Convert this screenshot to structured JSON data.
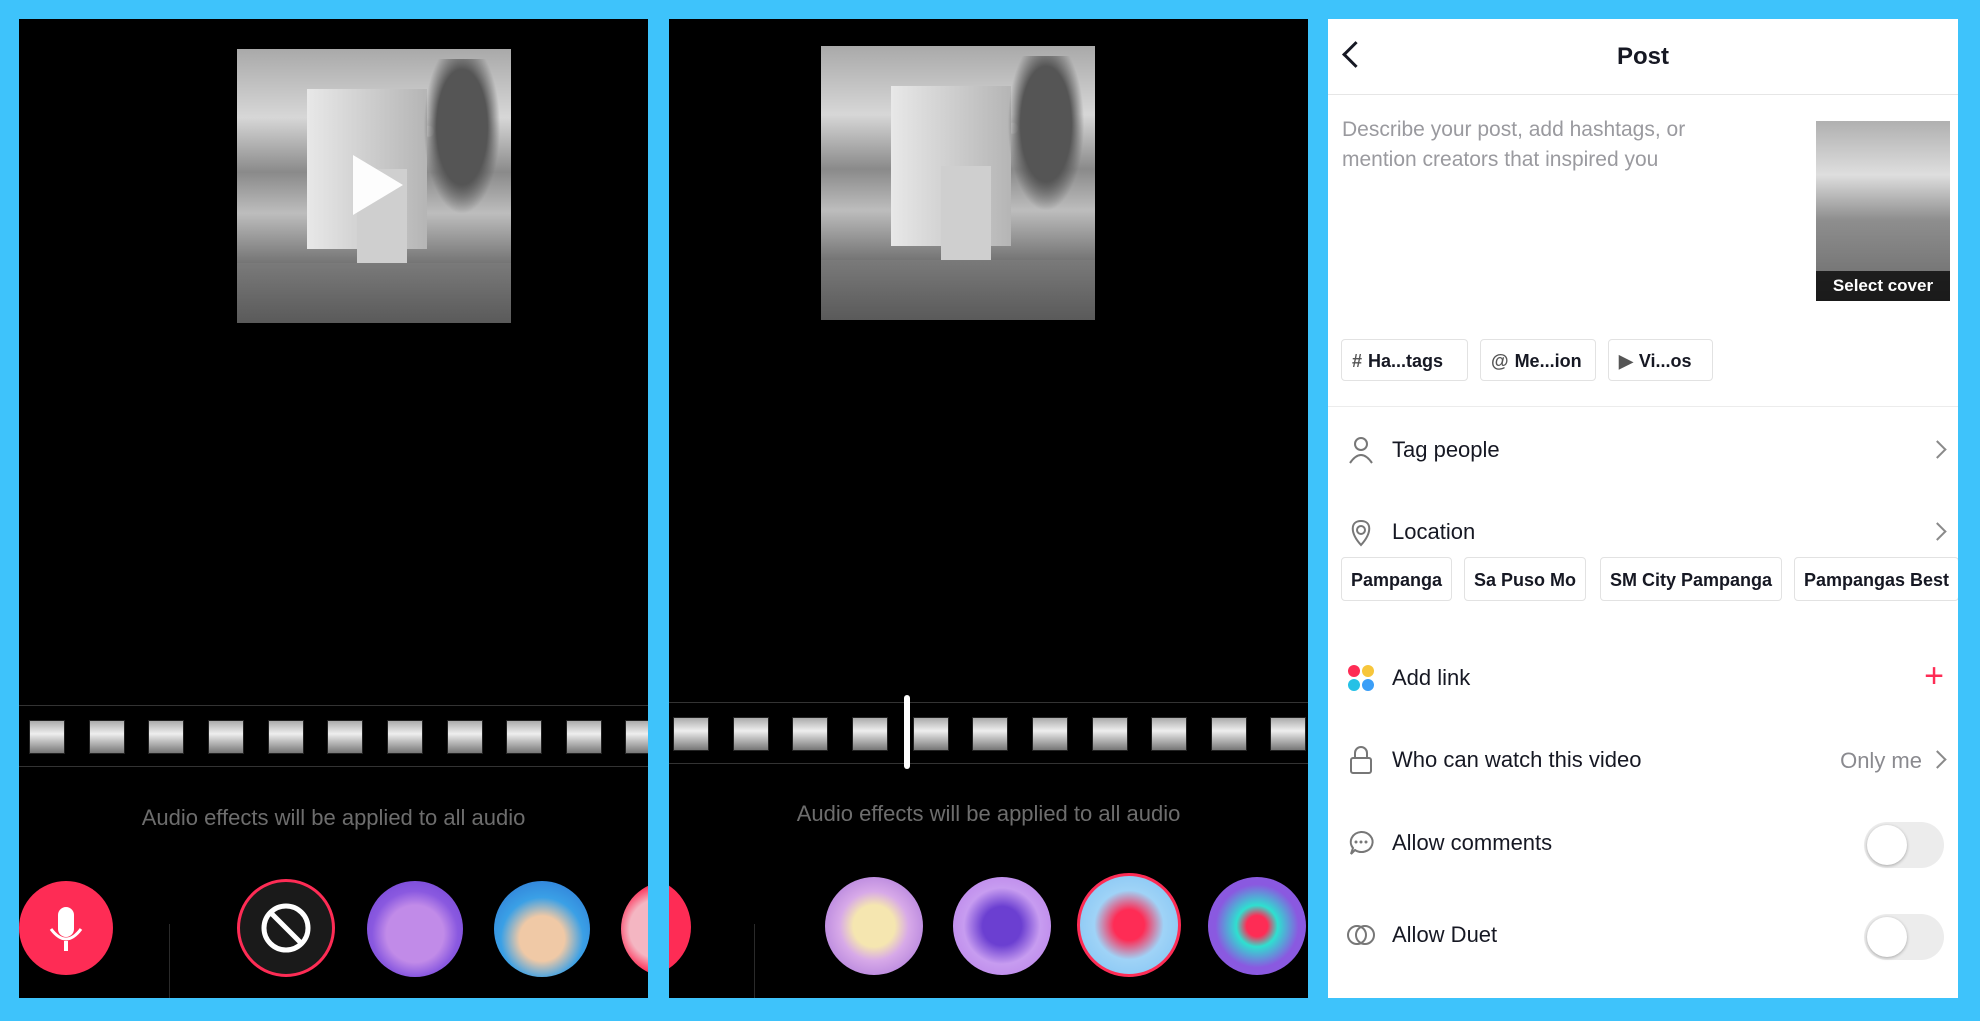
{
  "left_editor": {
    "audio_hint": "Audio effects will be applied to all audio"
  },
  "middle_editor": {
    "audio_hint": "Audio effects will be applied to all audio"
  },
  "post": {
    "title": "Post",
    "description_placeholder": "Describe your post, add hashtags, or mention creators that inspired you",
    "select_cover_label": "Select cover",
    "chips": [
      {
        "icon": "#",
        "label": "Ha...tags"
      },
      {
        "icon": "@",
        "label": "Me...ion"
      },
      {
        "icon": "▶",
        "label": "Vi...os"
      }
    ],
    "tag_people": "Tag people",
    "location": "Location",
    "location_suggestions": [
      "Pampanga",
      "Sa Puso Mo",
      "SM City Pampanga",
      "Pampangas Best"
    ],
    "add_link": "Add link",
    "who_can_watch": "Who can watch this video",
    "who_can_watch_value": "Only me",
    "allow_comments": "Allow comments",
    "allow_duet": "Allow Duet"
  },
  "colors": {
    "background": "#3ec3fb",
    "accent": "#fe2c55"
  }
}
